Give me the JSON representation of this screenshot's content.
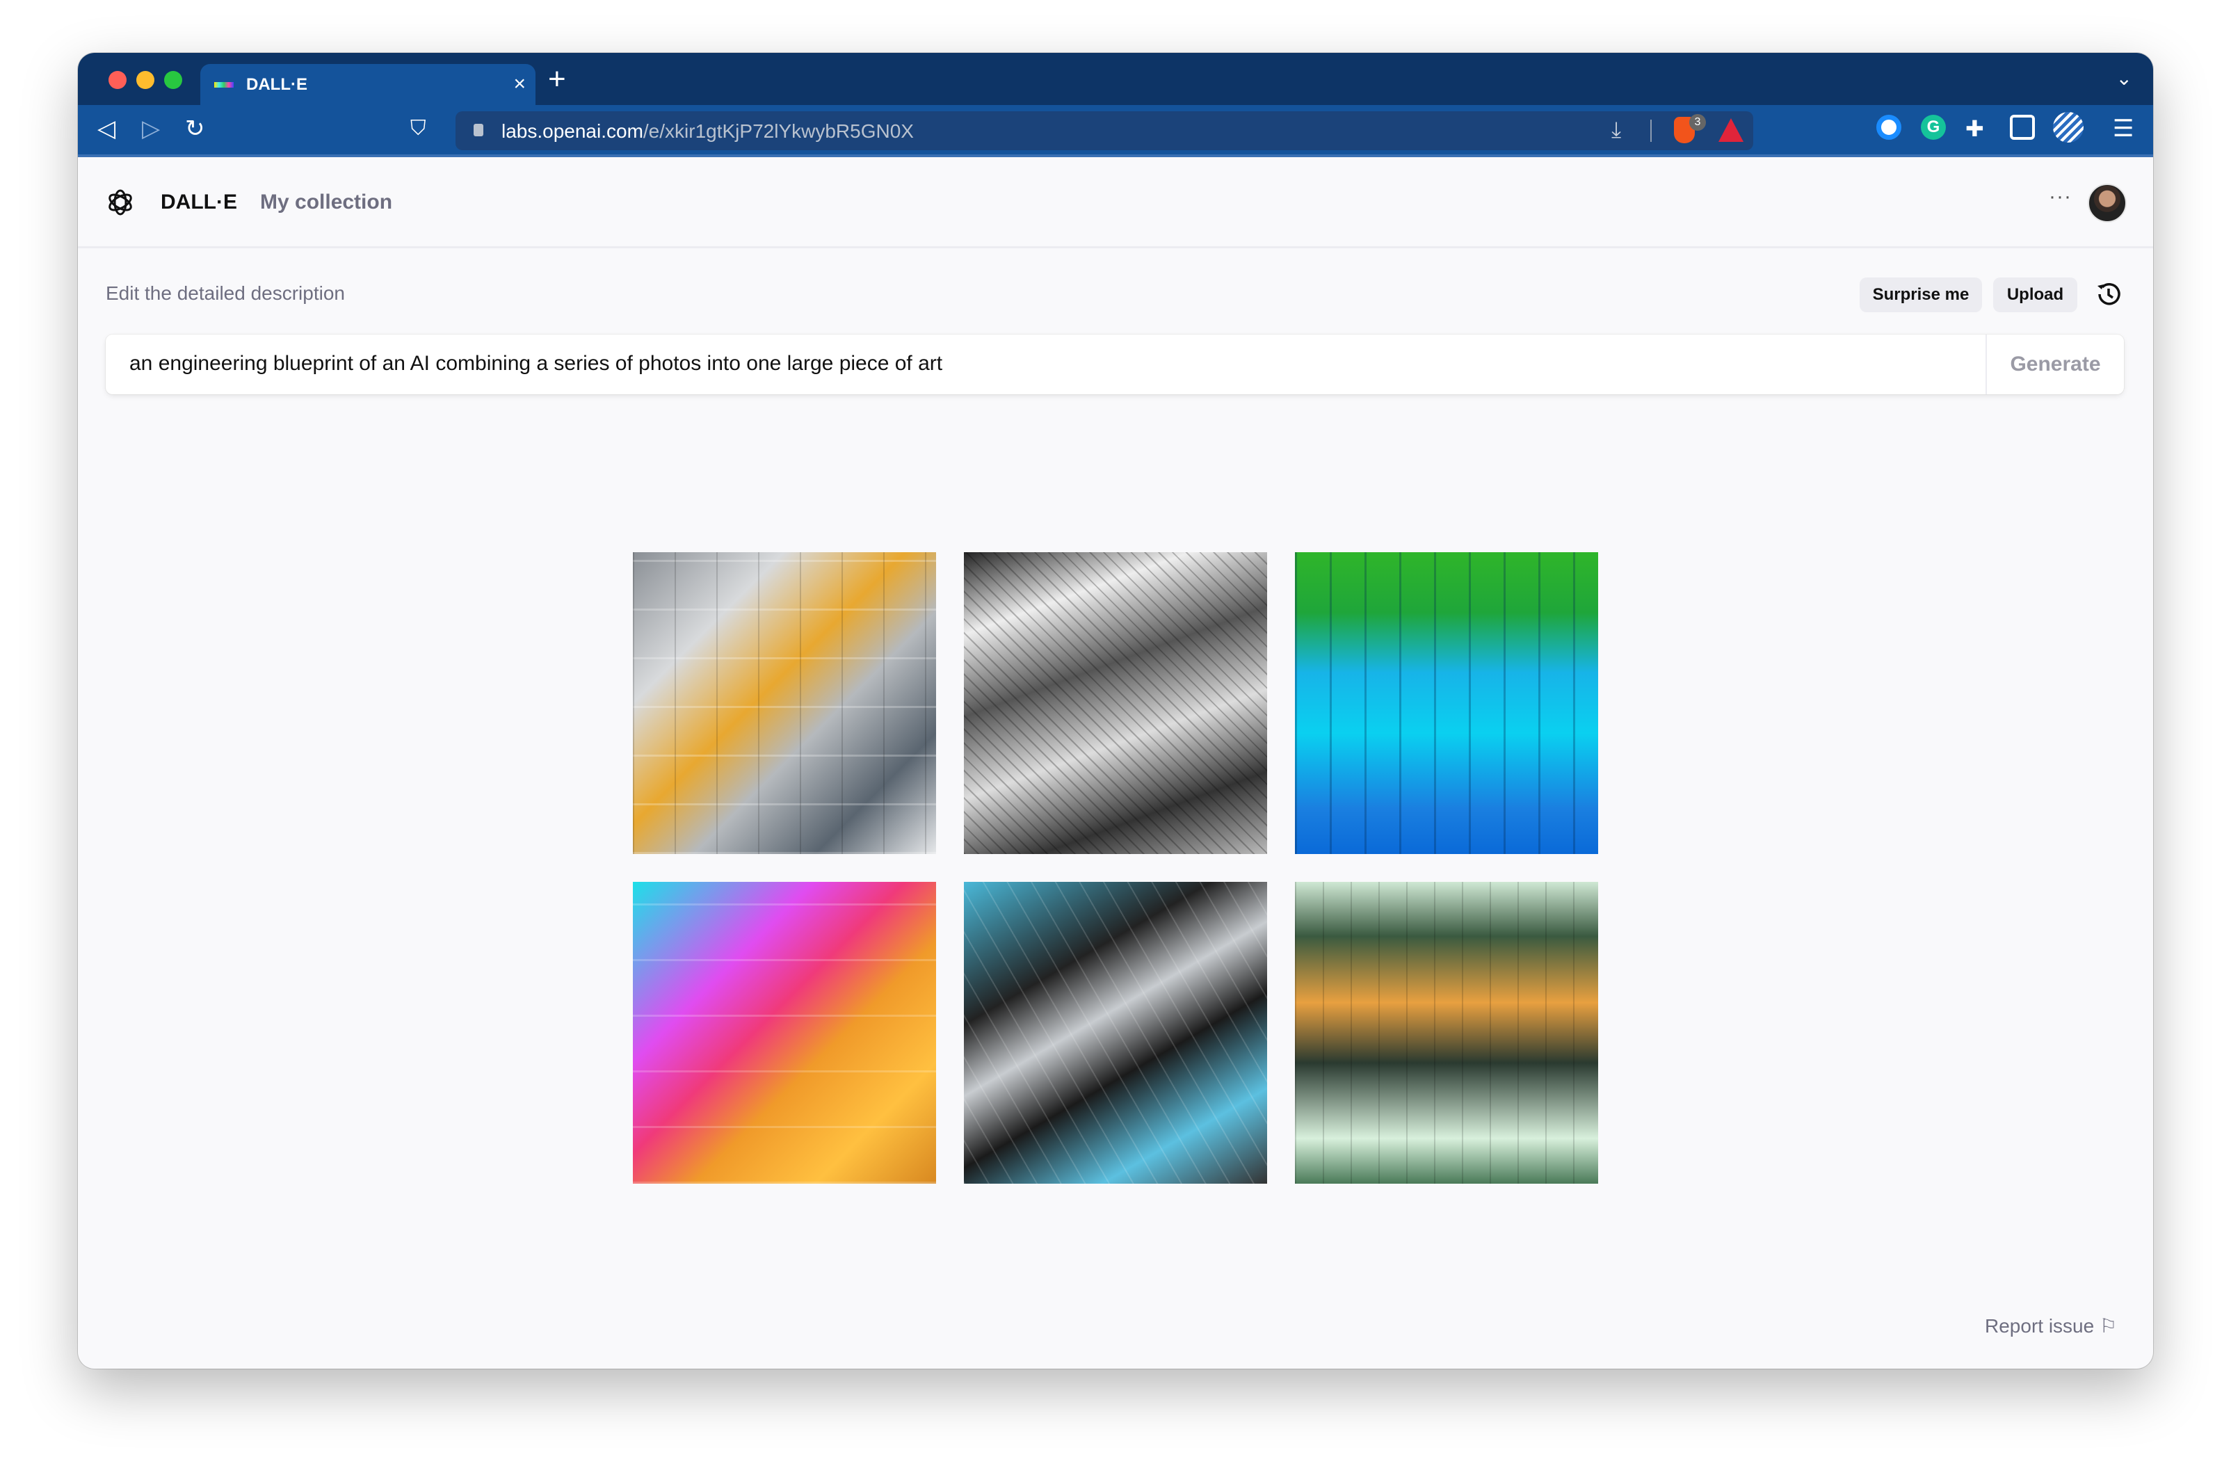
{
  "browser": {
    "tab_title": "DALL·E",
    "tab_close": "×",
    "new_tab": "+",
    "url_host": "labs.openai.com",
    "url_path": "/e/xkir1gtKjP72lYkwybR5GN0X",
    "brave_badge": "3",
    "icons": [
      "back-icon",
      "forward-icon",
      "reload-icon",
      "bookmark-icon",
      "lock-icon",
      "download-icon",
      "brave-shield-icon",
      "brave-rewards-icon",
      "1password-icon",
      "grammarly-icon",
      "extensions-icon",
      "wallet-icon",
      "profile-icon",
      "menu-icon"
    ]
  },
  "header": {
    "brand": "DALL·E",
    "my_collection": "My collection",
    "more": "···"
  },
  "editor": {
    "label": "Edit the detailed description",
    "surprise_me": "Surprise me",
    "upload": "Upload",
    "prompt": "an engineering blueprint of an AI combining a series of photos into one large piece of art",
    "generate": "Generate"
  },
  "results": {
    "count": 6
  },
  "footer": {
    "report_issue": "Report issue"
  }
}
